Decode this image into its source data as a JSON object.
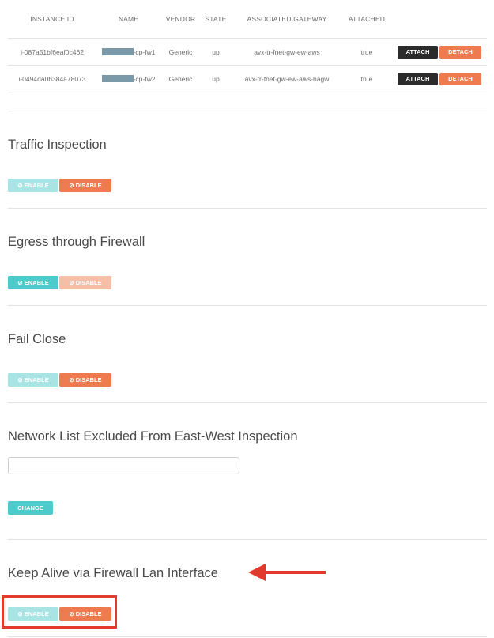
{
  "table": {
    "headers": [
      "INSTANCE ID",
      "NAME",
      "VENDOR",
      "STATE",
      "ASSOCIATED GATEWAY",
      "ATTACHED",
      ""
    ],
    "rows": [
      {
        "instance_id": "i-087a51bf6eaf0c462",
        "name_suffix": "-cp-fw1",
        "vendor": "Generic",
        "state": "up",
        "gateway": "avx-tr-fnet-gw-ew-aws",
        "attached": "true"
      },
      {
        "instance_id": "i-0494da0b384a78073",
        "name_suffix": "-cp-fw2",
        "vendor": "Generic",
        "state": "up",
        "gateway": "avx-tr-fnet-gw-ew-aws-hagw",
        "attached": "true"
      }
    ],
    "attach_label": "ATTACH",
    "detach_label": "DETACH"
  },
  "sections": {
    "traffic_inspection": {
      "title": "Traffic Inspection",
      "enable": "⊘ ENABLE",
      "disable": "⊘ DISABLE",
      "state": "disabled"
    },
    "egress_firewall": {
      "title": "Egress through Firewall",
      "enable": "⊘ ENABLE",
      "disable": "⊘ DISABLE",
      "state": "enabled"
    },
    "fail_close": {
      "title": "Fail Close",
      "enable": "⊘ ENABLE",
      "disable": "⊘ DISABLE",
      "state": "disabled"
    },
    "network_list": {
      "title": "Network List Excluded From East-West Inspection",
      "input_value": "",
      "change_label": "CHANGE"
    },
    "keep_alive": {
      "title": "Keep Alive via Firewall Lan Interface",
      "enable": "⊘ ENABLE",
      "disable": "⊘ DISABLE",
      "state": "disabled"
    }
  },
  "colors": {
    "enable_active": "#4fcacb",
    "enable_inactive": "#a9e4e4",
    "disable_active": "#ee7a4f",
    "disable_inactive": "#f6bda7",
    "attach": "#2b2b2b",
    "annotation": "#e23b2e"
  }
}
